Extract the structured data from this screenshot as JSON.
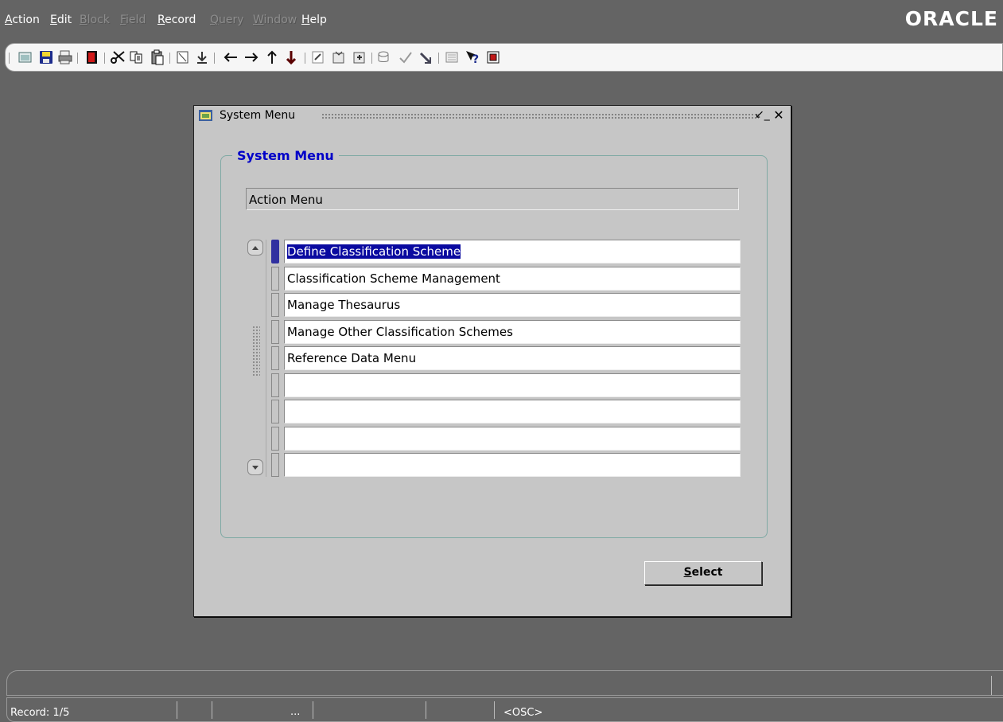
{
  "menubar": {
    "items": [
      {
        "label": "Action",
        "u": "A",
        "enabled": true
      },
      {
        "label": "Edit",
        "u": "E",
        "enabled": true
      },
      {
        "label": "Block",
        "u": "B",
        "enabled": false
      },
      {
        "label": "Field",
        "u": "F",
        "enabled": false
      },
      {
        "label": "Record",
        "u": "R",
        "enabled": true
      },
      {
        "label": "Query",
        "u": "Q",
        "enabled": false
      },
      {
        "label": "Window",
        "u": "W",
        "enabled": false
      },
      {
        "label": "Help",
        "u": "H",
        "enabled": true
      }
    ],
    "logo": "ORACLE"
  },
  "toolbar": {
    "icons": [
      "open-icon",
      "save-icon",
      "print-icon",
      "exit-icon",
      "cut-icon",
      "copy-icon",
      "paste-icon",
      "clear-icon",
      "duplicate-icon",
      "previous-icon",
      "next-icon",
      "previous-record-icon",
      "next-record-icon",
      "enter-query-icon",
      "execute-query-icon",
      "edit-icon",
      "list-of-values-icon",
      "validate-icon",
      "insert-icon",
      "help-icon",
      "window-icon"
    ]
  },
  "window": {
    "title": "System Menu",
    "frame_label": "System Menu",
    "action_field": "Action Menu",
    "rows": [
      "Define Classification Scheme",
      "Classification Scheme Management",
      "Manage Thesaurus",
      "Manage Other Classification Schemes",
      "Reference Data Menu",
      "",
      "",
      "",
      ""
    ],
    "selected_row": 0,
    "select_button": "Select",
    "select_underline": "S"
  },
  "statusbar": {
    "record": "Record: 1/5",
    "ellipsis": "...",
    "mode": "<OSC>"
  },
  "colors": {
    "background": "#646464",
    "window": "#c6c6c6",
    "frame_label": "#0000c8",
    "selection": "#0a0aa0"
  }
}
